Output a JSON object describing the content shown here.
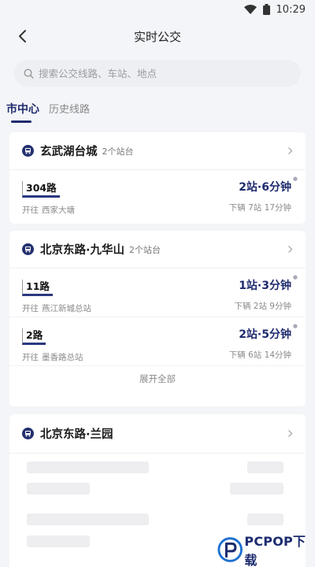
{
  "status_bar": {
    "time": "10:29"
  },
  "nav": {
    "title": "实时公交"
  },
  "search": {
    "placeholder": "搜索公交线路、车站、地点"
  },
  "tabs": [
    {
      "label": "市中心",
      "active": true
    },
    {
      "label": "历史线路",
      "active": false
    }
  ],
  "stops": [
    {
      "name": "玄武湖台城",
      "count": "2个站台",
      "routes": [
        {
          "line": "304路",
          "dest_prefix": "开往",
          "dest": "西家大塘",
          "eta": "2站·6分钟",
          "next": "下辆 7站 17分钟"
        }
      ]
    },
    {
      "name": "北京东路·九华山",
      "count": "2个站台",
      "routes": [
        {
          "line": "11路",
          "dest_prefix": "开往",
          "dest": "燕江新城总站",
          "eta": "1站·3分钟",
          "next": "下辆 2站 9分钟"
        },
        {
          "line": "2路",
          "dest_prefix": "开往",
          "dest": "墨香路总站",
          "eta": "2站·5分钟",
          "next": "下辆 6站 14分钟"
        }
      ],
      "expand_label": "展开全部"
    },
    {
      "name": "北京东路·兰园"
    }
  ],
  "watermark": {
    "brand": "PCPOP下载"
  },
  "colors": {
    "accent": "#1f2b6e",
    "background": "#f4f5f8",
    "card": "#ffffff"
  }
}
